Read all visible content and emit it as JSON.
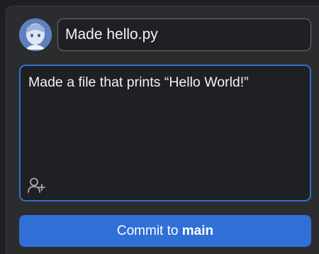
{
  "commit": {
    "summary": "Made hello.py",
    "description": "Made a file that prints “Hello World!”"
  },
  "button": {
    "prefix": "Commit to ",
    "branch": "main"
  },
  "icons": {
    "avatar": "user-avatar",
    "coauthor": "add-coauthor-icon"
  },
  "colors": {
    "accent": "#2f6fd6",
    "field_bg": "#1f2023",
    "panel_bg": "#2b2c2e"
  }
}
